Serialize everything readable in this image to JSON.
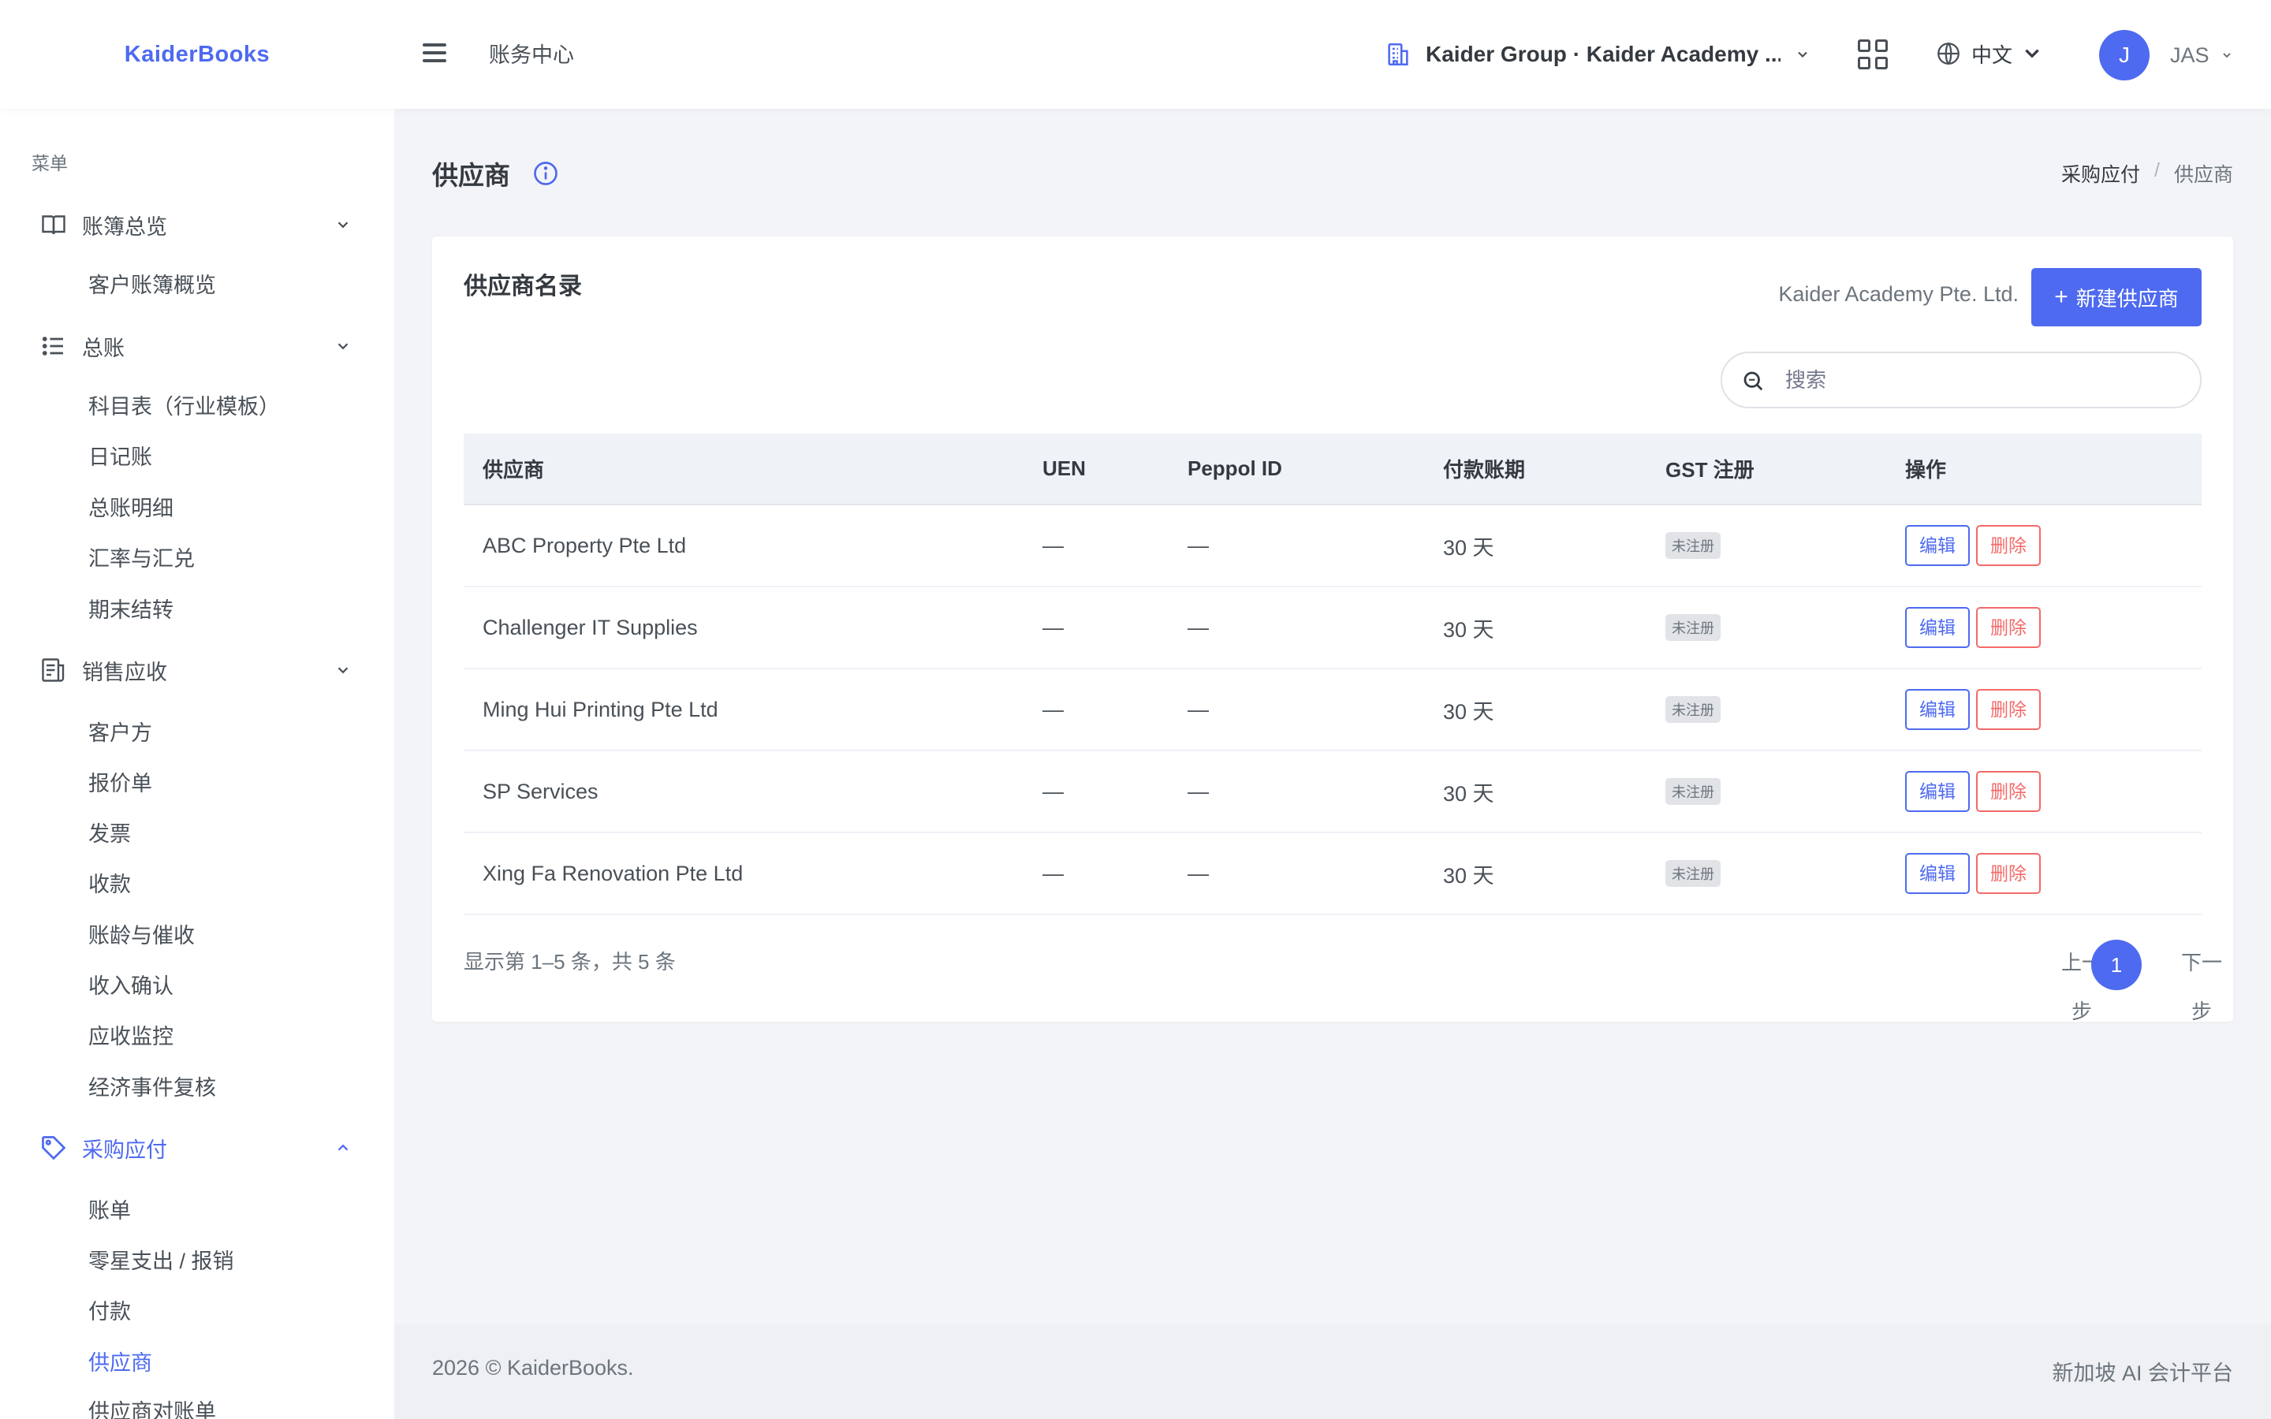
{
  "brand": "KaiderBooks",
  "topbar": {
    "title": "账务中心",
    "company": "Kaider Group · Kaider Academy ...",
    "language": "中文",
    "avatar_initial": "J",
    "user_name": "JAS"
  },
  "sidebar": {
    "menu_title": "菜单",
    "groups": [
      {
        "label": "账簿总览",
        "icon": "book-icon",
        "items": [
          "客户账簿概览"
        ]
      },
      {
        "label": "总账",
        "icon": "list-icon",
        "items": [
          "科目表（行业模板）",
          "日记账",
          "总账明细",
          "汇率与汇兑",
          "期末结转"
        ]
      },
      {
        "label": "销售应收",
        "icon": "receipt-icon",
        "items": [
          "客户方",
          "报价单",
          "发票",
          "收款",
          "账龄与催收",
          "收入确认",
          "应收监控",
          "经济事件复核"
        ]
      },
      {
        "label": "采购应付",
        "icon": "tag-icon",
        "items": [
          "账单",
          "零星支出 / 报销",
          "付款",
          "供应商",
          "供应商对账单"
        ]
      }
    ]
  },
  "page": {
    "title": "供应商",
    "breadcrumb": [
      "采购应付",
      "供应商"
    ],
    "breadcrumb_sep": "/"
  },
  "card": {
    "title": "供应商名录",
    "company_label": "Kaider Academy Pte. Ltd.",
    "new_button": "新建供应商",
    "search_placeholder": "搜索",
    "columns": [
      "供应商",
      "UEN",
      "Peppol ID",
      "付款账期",
      "GST 注册",
      "操作"
    ],
    "rows": [
      {
        "name": "ABC Property Pte Ltd",
        "uen": "—",
        "peppol": "—",
        "terms": "30 天",
        "gst": "未注册"
      },
      {
        "name": "Challenger IT Supplies",
        "uen": "—",
        "peppol": "—",
        "terms": "30 天",
        "gst": "未注册"
      },
      {
        "name": "Ming Hui Printing Pte Ltd",
        "uen": "—",
        "peppol": "—",
        "terms": "30 天",
        "gst": "未注册"
      },
      {
        "name": "SP Services",
        "uen": "—",
        "peppol": "—",
        "terms": "30 天",
        "gst": "未注册"
      },
      {
        "name": "Xing Fa Renovation Pte Ltd",
        "uen": "—",
        "peppol": "—",
        "terms": "30 天",
        "gst": "未注册"
      }
    ],
    "edit_label": "编辑",
    "delete_label": "删除",
    "showing": "显示第 1–5 条，共 5 条",
    "pager": {
      "prev": "上一步",
      "current": "1",
      "next": "下一步"
    }
  },
  "footer": {
    "left": "2026 © KaiderBooks.",
    "right": "新加坡 AI 会计平台"
  },
  "colors": {
    "accent": "#4e6af0",
    "danger": "#f46a6a"
  }
}
